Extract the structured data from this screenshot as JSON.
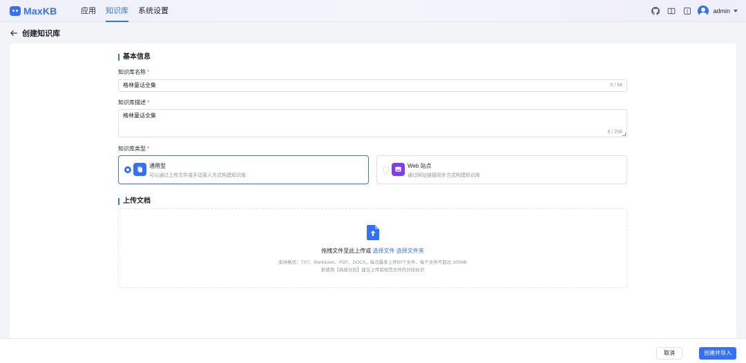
{
  "header": {
    "logo_text": "MaxKB",
    "nav": [
      "应用",
      "知识库",
      "系统设置"
    ],
    "active_nav": "知识库",
    "user_name": "admin",
    "icons": [
      "github-icon",
      "book-icon",
      "help-icon"
    ]
  },
  "page": {
    "title": "创建知识库"
  },
  "basic": {
    "section_title": "基本信息",
    "name_label": "知识库名称",
    "name_value": "格林童话全集",
    "name_count": "6 / 64",
    "desc_label": "知识库描述",
    "desc_value": "格林童话全集",
    "desc_count": "6 / 256",
    "type_label": "知识库类型",
    "required_mark": "*",
    "types": [
      {
        "name": "通用型",
        "desc": "可以通过上传文件或手动录入方式构建知识库",
        "selected": true
      },
      {
        "name": "Web 站点",
        "desc": "通过网站链接同步方式构建知识库",
        "selected": false
      }
    ]
  },
  "upload": {
    "section_title": "上传文档",
    "main_text": "拖拽文件至此上传或",
    "select_file": "选择文件",
    "select_folder": "选择文件夹",
    "hint1": "支持格式：TXT、Markdown、PDF、DOCX，每次最多上传50个文件，每个文件不超过 100MB",
    "hint2": "若使用【高级分段】建议上传前规范文件的分段标识"
  },
  "footer": {
    "cancel": "取消",
    "create": "创建并导入"
  },
  "colors": {
    "primary": "#3370ff",
    "required": "#f54a45",
    "web_icon": "#7f3bf5"
  }
}
